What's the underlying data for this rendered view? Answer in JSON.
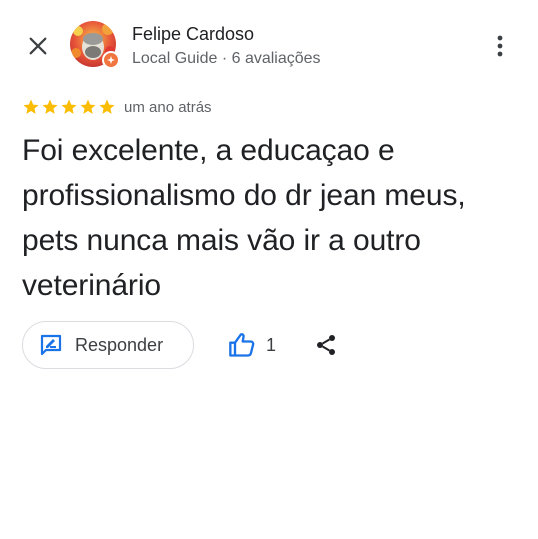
{
  "author": {
    "name": "Felipe Cardoso",
    "meta": "Local Guide · 6 avaliações"
  },
  "review": {
    "rating": 5,
    "max_rating": 5,
    "date": "um ano atrás",
    "text": "Foi excelente, a educaçao e profissionalismo do dr jean meus, pets nunca mais vão ir a outro veterinário"
  },
  "actions": {
    "reply_label": "Responder",
    "like_count": "1"
  },
  "icons": {
    "close": "close-icon",
    "more": "more-vert-icon",
    "star": "star-icon",
    "reply": "reply-icon",
    "like": "thumb-up-icon",
    "share": "share-icon",
    "local_guide_badge": "local-guide-badge-icon"
  },
  "colors": {
    "star": "#fbbc04",
    "accent": "#1a73e8",
    "badge": "#f0753f",
    "text_primary": "#202124",
    "text_secondary": "#5f6368"
  }
}
